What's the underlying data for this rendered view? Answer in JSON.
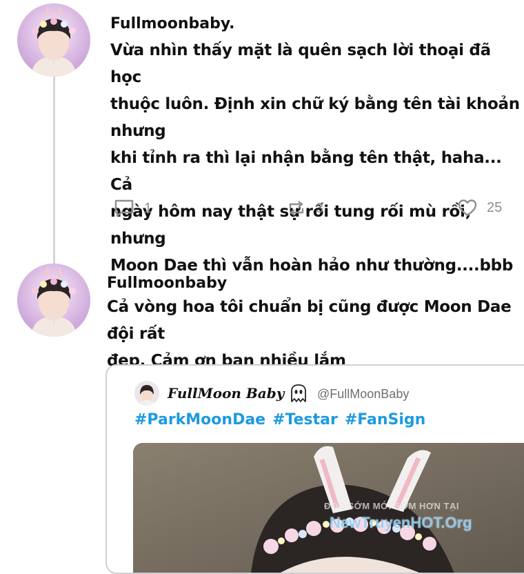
{
  "posts": [
    {
      "author": "Fullmoonbaby.",
      "text_lines": [
        "Vừa nhìn thấy mặt là quên sạch lời thoại đã học",
        "thuộc luôn. Định xin chữ ký bằng tên tài khoản nhưng",
        "khi tỉnh ra thì lại nhận bằng tên thật, haha... Cả",
        "ngày hôm nay thật sự rối tung rối mù rồi, nhưng",
        "Moon Dae thì vẫn hoàn hảo như thường....bbb"
      ],
      "actions": {
        "replies": "1",
        "reposts": "3",
        "likes": "25"
      }
    },
    {
      "author": "Fullmoonbaby",
      "text_lines": [
        "Cả vòng hoa tôi chuẩn bị cũng được Moon Dae đội rất",
        "đẹp. Cảm ơn bạn nhiều lắm"
      ]
    }
  ],
  "quoted_post": {
    "display_name": "FullMoon Baby",
    "handle": "@FullMoonBaby",
    "hashtags": [
      "#ParkMoonDae",
      "#Testar",
      "#FanSign"
    ]
  },
  "watermark": {
    "line1": "ĐỌC SỚM MỚI SỚM HƠN TẠI",
    "line2": "NewTruyenHOT.Org"
  },
  "colors": {
    "hashtag": "#1d9ae0",
    "icon_gray": "#8e8e93",
    "thread_line": "#d5d5d8",
    "card_border": "#cfcfd4"
  },
  "icons": [
    "reply-icon",
    "repost-icon",
    "heart-icon",
    "ghost-emoji-icon"
  ]
}
